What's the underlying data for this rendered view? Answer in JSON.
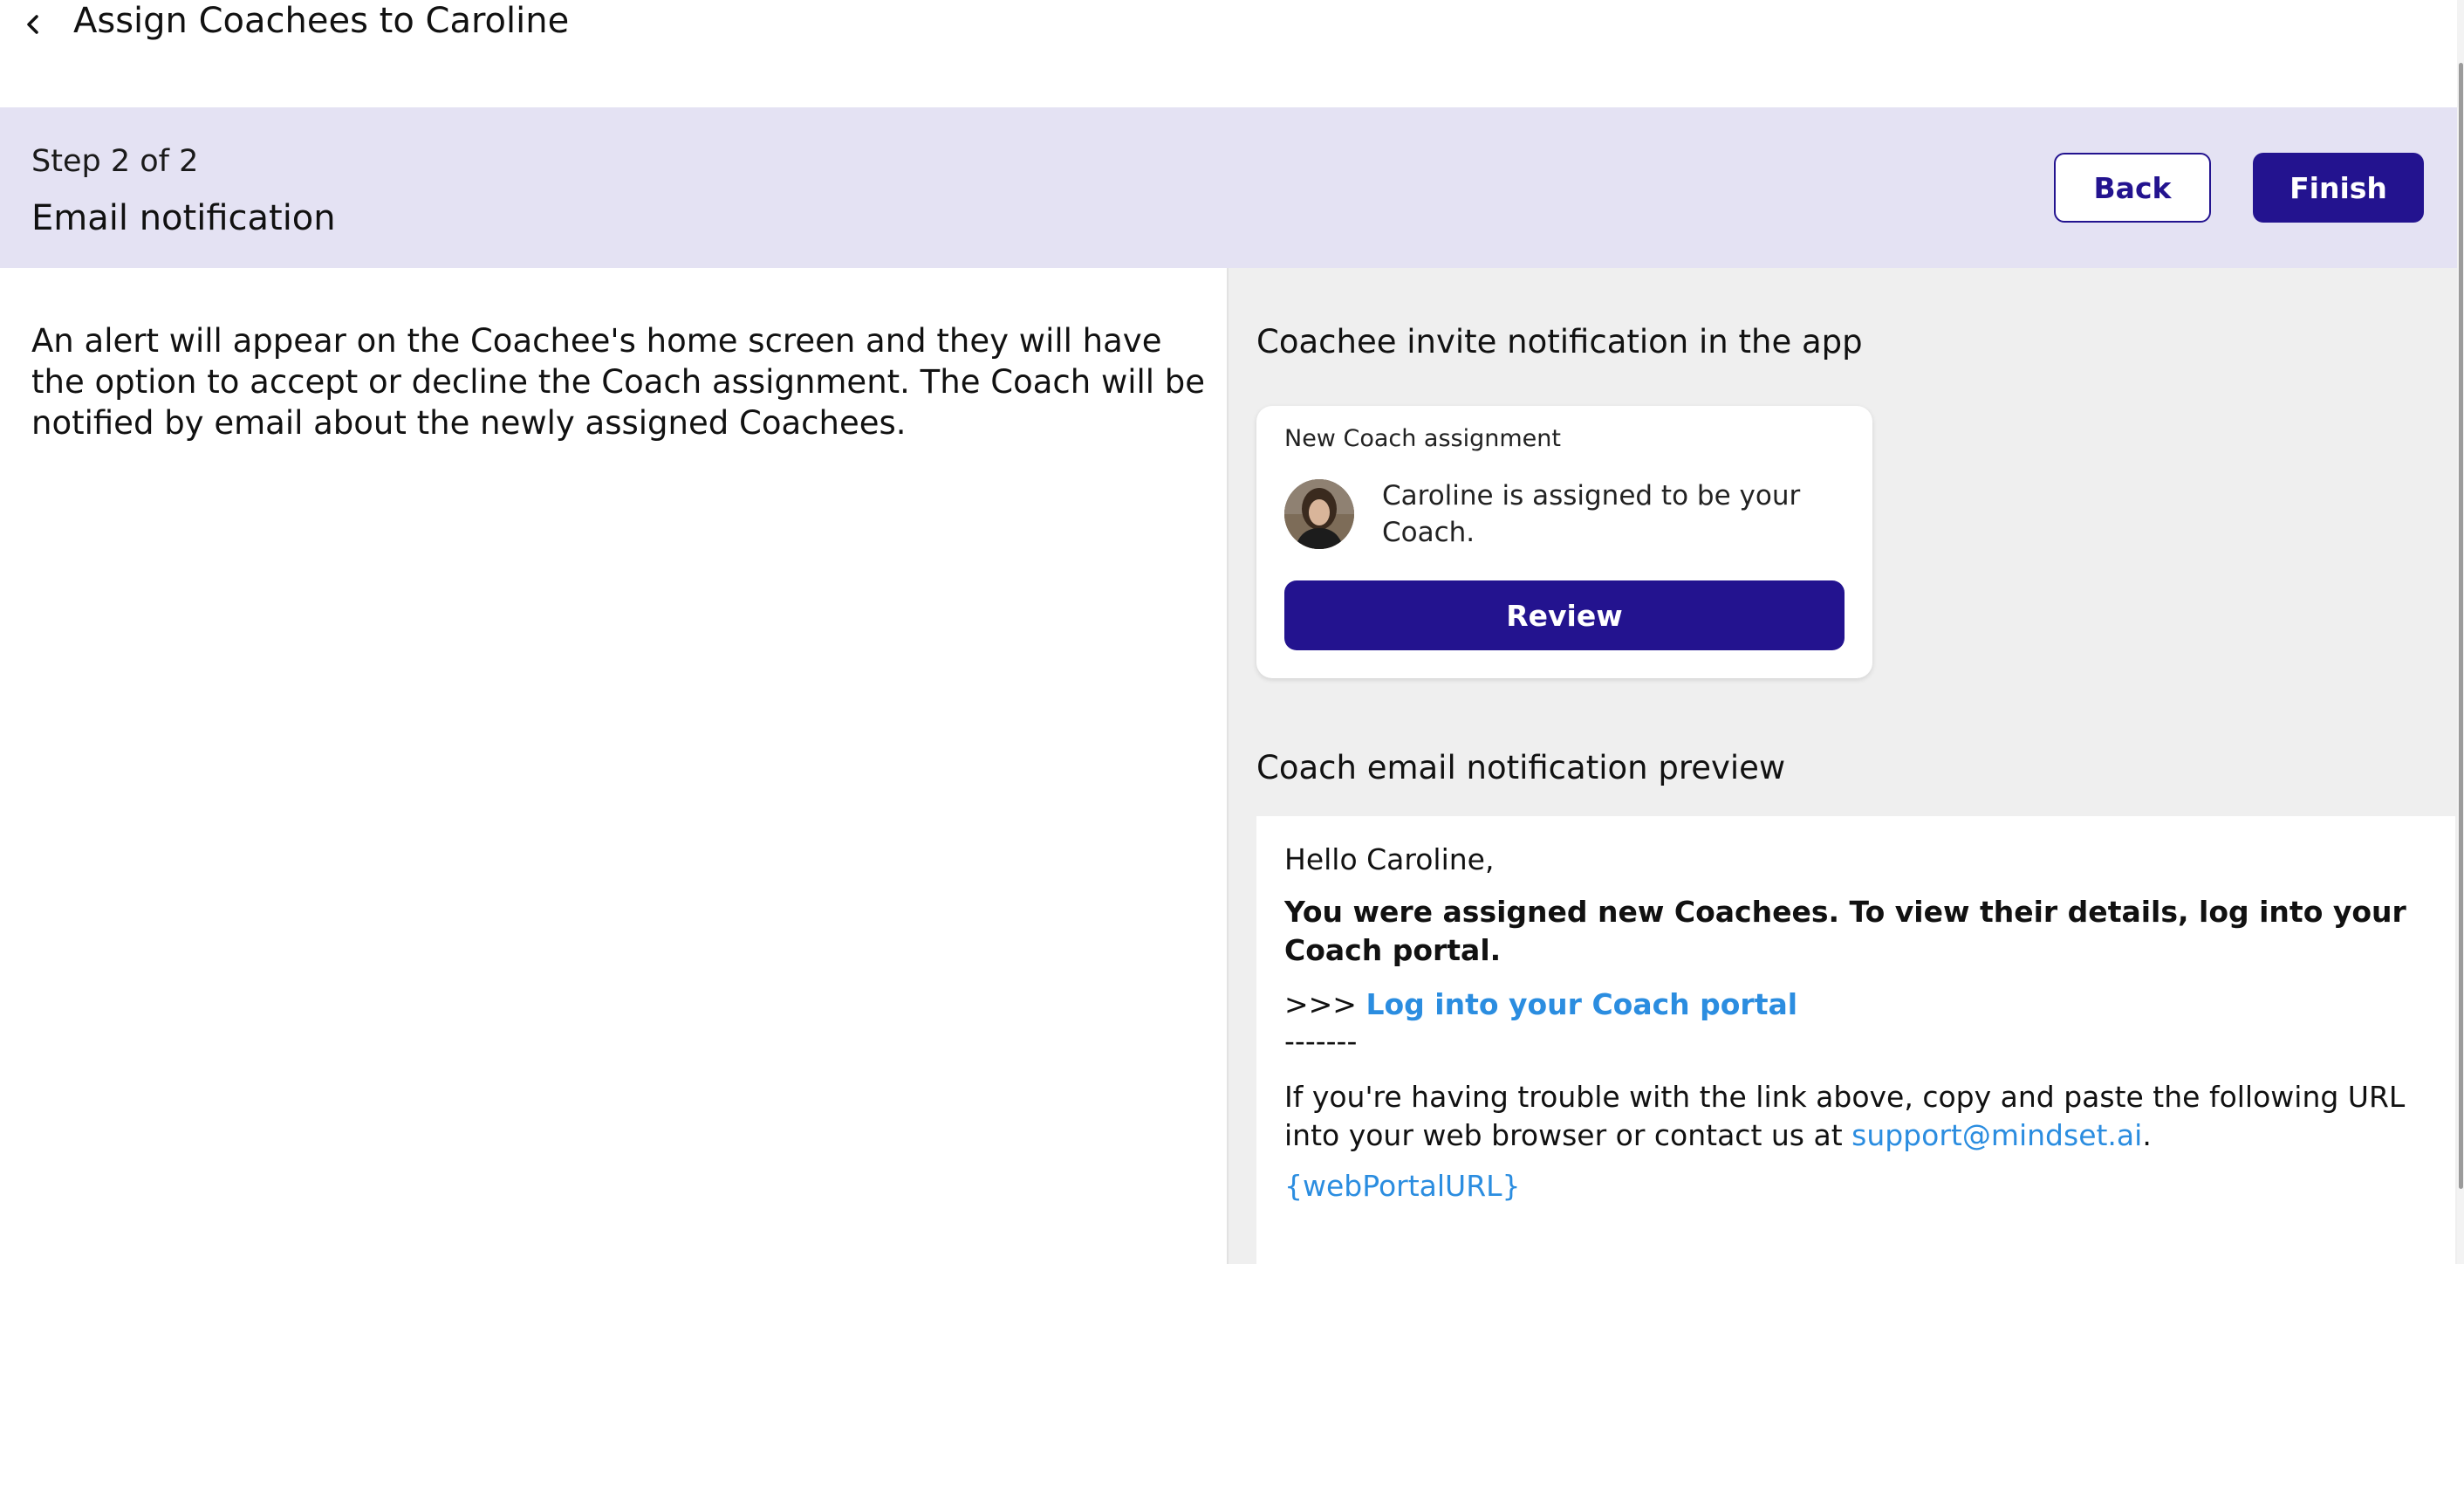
{
  "header": {
    "back_icon": "chevron-left-icon",
    "title": "Assign Coachees to Caroline"
  },
  "stepbar": {
    "step": "Step 2 of 2",
    "title": "Email notification",
    "back_label": "Back",
    "finish_label": "Finish"
  },
  "left": {
    "description": "An alert will appear on the Coachee's home screen and they will have the option to accept or decline the Coach assignment. The Coach will be notified by email about the newly assigned Coachees."
  },
  "invite": {
    "heading": "Coachee invite notification in the app",
    "card_header": "New Coach assignment",
    "message": "Caroline is assigned to be your Coach.",
    "review_label": "Review"
  },
  "email": {
    "heading": "Coach email notification preview",
    "greeting": "Hello Caroline,",
    "bold_text": "You were assigned new Coachees. To view their details, log into your Coach portal.",
    "link_prefix": ">>> ",
    "link_text": "Log into your Coach portal",
    "divider": "-------",
    "trouble_text": "If you're having trouble with the link above, copy and paste the following URL into your web browser or contact us at ",
    "support_email": "support@mindset.ai",
    "trouble_end": ".",
    "portal_url": "{webPortalURL}"
  },
  "colors": {
    "accent": "#23138f",
    "stepbar_bg": "#e4e2f3",
    "link": "#2b8de0",
    "right_pane_bg": "#efefef"
  }
}
